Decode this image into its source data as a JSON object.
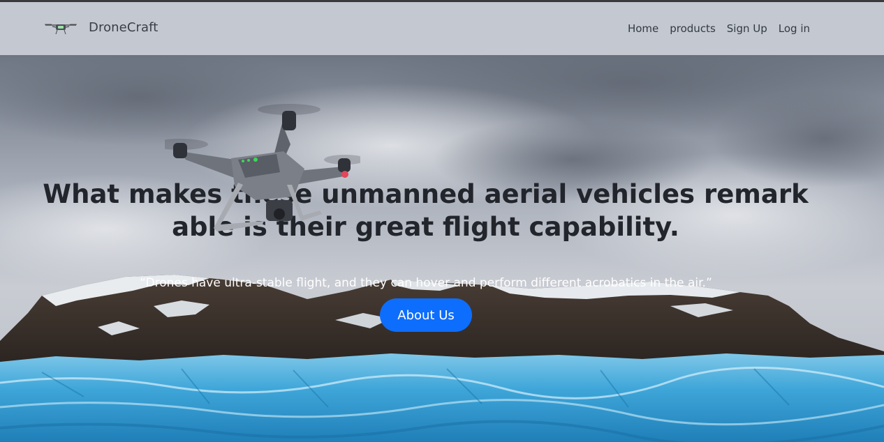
{
  "navbar": {
    "brand_icon": "drone-logo-icon",
    "brand_name": "DroneCraft",
    "links": [
      {
        "label": "Home"
      },
      {
        "label": "products"
      },
      {
        "label": "Sign Up"
      },
      {
        "label": "Log in"
      }
    ]
  },
  "hero": {
    "background_image": "glacier-mountain-cloudy-sky",
    "drone_image": "quadcopter-drone",
    "headline": "What makes these unmanned aerial vehicles remarkable is their great flight capability.",
    "quote": "“Drones have ultra-stable flight, and they can hover and perform different acrobatics in the air.”",
    "cta_label": "About Us"
  },
  "colors": {
    "navbar_bg": "#c4c8d1",
    "button_bg": "#0d6efd",
    "headline_text": "#22252b",
    "quote_text": "#ffffff"
  }
}
